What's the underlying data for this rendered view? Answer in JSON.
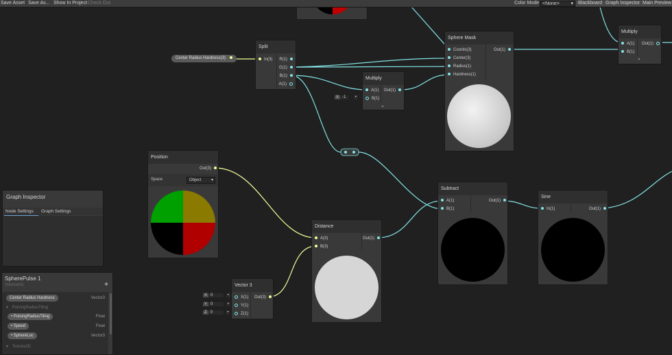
{
  "toolbar": {
    "save_asset": "Save Asset",
    "save_as": "Save As...",
    "show_in_project": "Show In Project",
    "check_out": "Check Out",
    "color_mode_label": "Color Mode",
    "color_mode_value": "<None>",
    "blackboard": "Blackboard",
    "graph_inspector": "Graph Inspector",
    "main_preview": "Main Preview"
  },
  "property_pill": "Center Radius Hardness(3)",
  "nodes": {
    "split": {
      "title": "Split",
      "inputs": [
        "In(3)"
      ],
      "outputs": [
        "R(1)",
        "G(1)",
        "B(1)",
        "A(1)"
      ]
    },
    "multiply_small": {
      "title": "Multiply",
      "inputs": [
        "A(1)",
        "B(1)"
      ],
      "outputs": [
        "Out(1)"
      ],
      "const_label": "X",
      "const_value": "-1"
    },
    "sphere_mask": {
      "title": "Sphere Mask",
      "inputs": [
        "Coords(3)",
        "Center(3)",
        "Radius(1)",
        "Hardness(1)"
      ],
      "outputs": [
        "Out(1)"
      ]
    },
    "multiply_right": {
      "title": "Multiply",
      "inputs": [
        "A(1)",
        "B(1)"
      ],
      "outputs": [
        "Out(1)"
      ]
    },
    "position": {
      "title": "Position",
      "outputs": [
        "Out(3)"
      ],
      "space_label": "Space",
      "space_value": "Object"
    },
    "distance": {
      "title": "Distance",
      "inputs": [
        "A(3)",
        "B(3)"
      ],
      "outputs": [
        "Out(1)"
      ]
    },
    "subtract": {
      "title": "Subtract",
      "inputs": [
        "A(1)",
        "B(1)"
      ],
      "outputs": [
        "Out(1)"
      ]
    },
    "sine": {
      "title": "Sine",
      "inputs": [
        "In(1)"
      ],
      "outputs": [
        "Out(1)"
      ]
    },
    "vector3": {
      "title": "Vector 3",
      "inputs": [
        "X(1)",
        "Y(1)",
        "Z(1)"
      ],
      "outputs": [
        "Out(3)"
      ],
      "consts": [
        {
          "label": "X",
          "value": "0"
        },
        {
          "label": "Y",
          "value": "0"
        },
        {
          "label": "Z",
          "value": "0"
        }
      ]
    }
  },
  "graph_inspector": {
    "title": "Graph Inspector",
    "tabs": [
      "Node Settings",
      "Graph Settings"
    ]
  },
  "blackboard": {
    "title": "SpherePulse 1",
    "subtitle": "Volumetric",
    "add_icon": "+",
    "property": {
      "name": "Center Radius Hardness",
      "type": "Vector3"
    },
    "category": "PulsingRadiusTiling",
    "items": [
      {
        "name": "PulsingRadiusTiling",
        "type": "Float"
      },
      {
        "name": "Speed",
        "type": "Float"
      },
      {
        "name": "SphereLoc",
        "type": "Vector3"
      }
    ],
    "category2": "Texture3D"
  },
  "colors": {
    "background": "#202020",
    "node": "#393939",
    "wire_blue": "#84e4e7",
    "wire_yellow": "#f6ff9a"
  }
}
